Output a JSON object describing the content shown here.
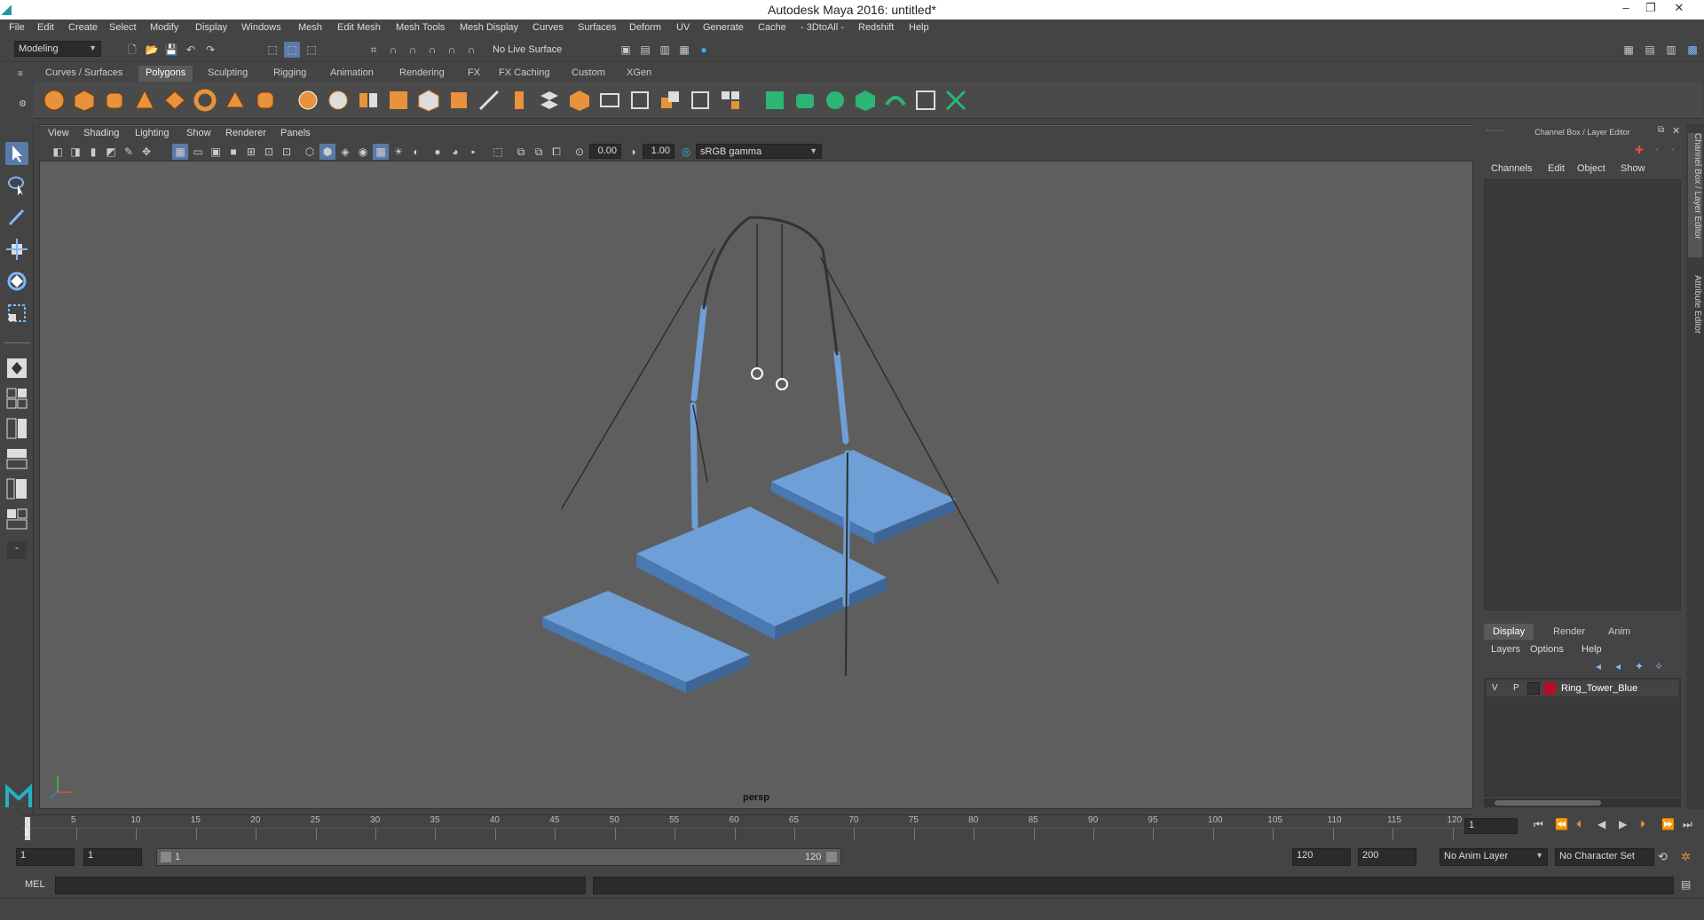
{
  "window": {
    "title": "Autodesk Maya 2016: untitled*"
  },
  "menubar": [
    "File",
    "Edit",
    "Create",
    "Select",
    "Modify",
    "Display",
    "Windows",
    "Mesh",
    "Edit Mesh",
    "Mesh Tools",
    "Mesh Display",
    "Curves",
    "Surfaces",
    "Deform",
    "UV",
    "Generate",
    "Cache",
    "- 3DtoAll -",
    "Redshift",
    "Help"
  ],
  "statusline": {
    "mode": "Modeling",
    "live_surface": "No Live Surface"
  },
  "shelf_tabs": [
    "Curves / Surfaces",
    "Polygons",
    "Sculpting",
    "Rigging",
    "Animation",
    "Rendering",
    "FX",
    "FX Caching",
    "Custom",
    "XGen"
  ],
  "shelf_active": "Polygons",
  "panel_menu": [
    "View",
    "Shading",
    "Lighting",
    "Show",
    "Renderer",
    "Panels"
  ],
  "view_toolbar": {
    "exposure": "0.00",
    "gamma": "1.00",
    "color_space": "sRGB gamma"
  },
  "viewport": {
    "camera": "persp"
  },
  "channel_box": {
    "header": "Channel Box / Layer Editor",
    "menus": [
      "Channels",
      "Edit",
      "Object",
      "Show"
    ]
  },
  "layer_editor": {
    "tabs": [
      "Display",
      "Render",
      "Anim"
    ],
    "active_tab": "Display",
    "menus": [
      "Layers",
      "Options",
      "Help"
    ],
    "layers": [
      {
        "v": "V",
        "p": "P",
        "name": "Ring_Tower_Blue",
        "color": "#b0102a"
      }
    ]
  },
  "side_tabs": [
    "Channel Box / Layer Editor",
    "Attribute Editor"
  ],
  "timeline": {
    "ticks": [
      "5",
      "10",
      "15",
      "20",
      "25",
      "30",
      "35",
      "40",
      "45",
      "50",
      "55",
      "60",
      "65",
      "70",
      "75",
      "80",
      "85",
      "90",
      "95",
      "100",
      "105",
      "110",
      "115",
      "120"
    ],
    "start_label": "1",
    "current_frame": "1"
  },
  "range": {
    "start": "1",
    "playback_start": "1",
    "slider_start": "1",
    "slider_end": "120",
    "playback_end": "120",
    "end": "200",
    "anim_layer": "No Anim Layer",
    "character_set": "No Character Set"
  },
  "command_line": {
    "label": "MEL"
  },
  "colors": {
    "accent_blue": "#6e9fd6",
    "model_blue": "#5b8bc4",
    "viewport_bg": "#5e5e5e"
  }
}
